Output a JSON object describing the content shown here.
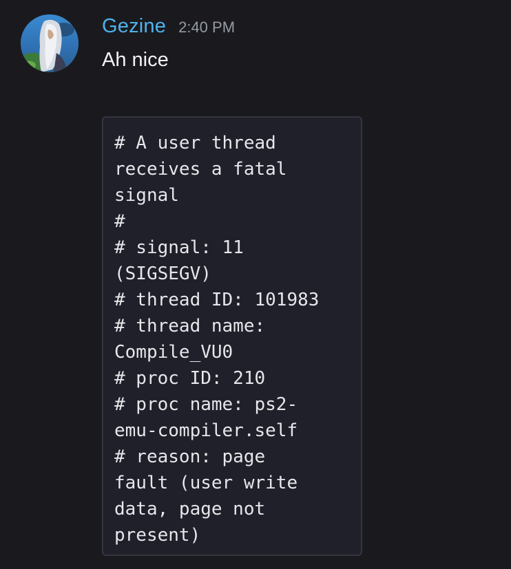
{
  "message": {
    "author": "Gezine",
    "timestamp": "2:40 PM",
    "text": "Ah nice",
    "author_color": "#4fb3ee",
    "avatar": "anime-character-avatar"
  },
  "code_block": {
    "lines": [
      "# A user thread",
      "receives a fatal",
      "signal",
      "#",
      "# signal: 11",
      "(SIGSEGV)",
      "# thread ID: 101983",
      "# thread name:",
      "Compile_VU0",
      "# proc ID: 210",
      "# proc name: ps2-",
      "emu-compiler.self",
      "# reason: page",
      "fault (user write",
      "data, page not",
      "present)"
    ]
  },
  "colors": {
    "background": "#1a1a1e",
    "code_background": "#1f2029",
    "code_border": "#34363e",
    "timestamp": "#949ba4"
  }
}
